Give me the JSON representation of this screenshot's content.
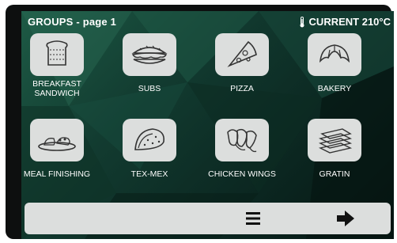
{
  "header": {
    "title": "GROUPS - page 1",
    "status": "CURRENT 210°C"
  },
  "groups": [
    {
      "label": "BREAKFAST SANDWICH",
      "icon": "sandwich-icon"
    },
    {
      "label": "SUBS",
      "icon": "sub-sandwich-icon"
    },
    {
      "label": "PIZZA",
      "icon": "pizza-slice-icon"
    },
    {
      "label": "BAKERY",
      "icon": "croissant-icon"
    },
    {
      "label": "MEAL FINISHING",
      "icon": "plated-meal-icon"
    },
    {
      "label": "TEX-MEX",
      "icon": "taco-icon"
    },
    {
      "label": "CHICKEN WINGS",
      "icon": "chicken-wings-icon"
    },
    {
      "label": "GRATIN",
      "icon": "gratin-layers-icon"
    }
  ],
  "footer": {
    "menu_icon": "menu-icon",
    "next_icon": "right-arrow-icon"
  }
}
